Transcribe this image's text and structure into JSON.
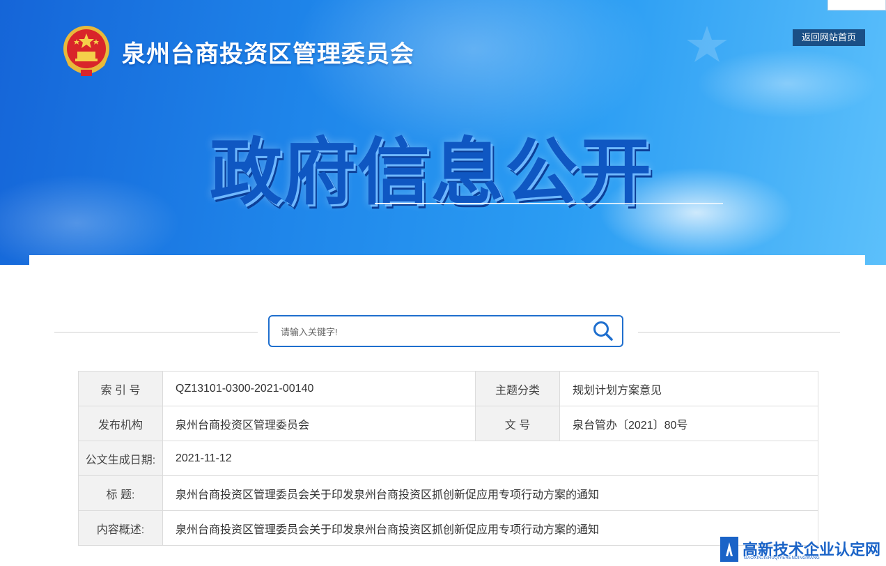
{
  "header": {
    "org_name": "泉州台商投资区管理委员会",
    "home_link": "返回网站首页",
    "hero_title": "政府信息公开"
  },
  "search": {
    "placeholder": "请输入关键字!",
    "icon": "search-icon"
  },
  "info": {
    "index_label": "索 引 号",
    "index_value": "QZ13101-0300-2021-00140",
    "topic_label": "主题分类",
    "topic_value": "规划计划方案意见",
    "publisher_label": "发布机构",
    "publisher_value": "泉州台商投资区管理委员会",
    "docno_label": "文 号",
    "docno_value": "泉台管办〔2021〕80号",
    "date_label": "公文生成日期:",
    "date_value": "2021-11-12",
    "title_label": "标 题:",
    "title_value": "泉州台商投资区管理委员会关于印发泉州台商投资区抓创新促应用专项行动方案的通知",
    "summary_label": "内容概述:",
    "summary_value": "泉州台商投资区管理委员会关于印发泉州台商投资区抓创新促应用专项行动方案的通知"
  },
  "watermark": {
    "title": "高新技术企业认定网",
    "subtitle": "GAOXINJISHUQIYERENDINGWANG"
  },
  "colors": {
    "banner_dark": "#1565d8",
    "banner_light": "#5cc0fb",
    "accent": "#1f6fce",
    "home_link_bg": "#1a4f86"
  }
}
